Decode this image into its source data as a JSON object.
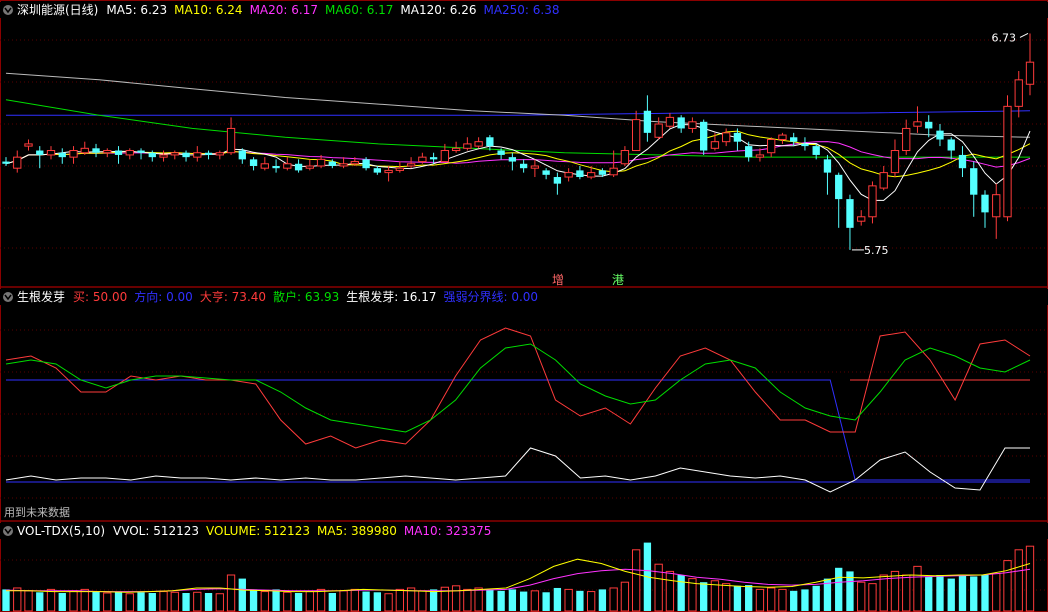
{
  "colors": {
    "bg": "#000000",
    "up": "#ff3b3b",
    "down": "#54ffff",
    "panel_border": "#8b0000",
    "grid": "#5a0000",
    "white": "#ffffff",
    "yellow": "#ffff00",
    "magenta": "#ff33ff",
    "green": "#00dd00",
    "blue": "#3030ff"
  },
  "panel1": {
    "title": "深圳能源(日线)",
    "icon": "chevron-down-icon",
    "indicators": [
      {
        "label": "MA5: 6.23",
        "color": "#ffffff"
      },
      {
        "label": "MA10: 6.24",
        "color": "#ffff00"
      },
      {
        "label": "MA20: 6.17",
        "color": "#ff33ff"
      },
      {
        "label": "MA60: 6.17",
        "color": "#00dd00"
      },
      {
        "label": "MA120: 6.26",
        "color": "#ffffff"
      },
      {
        "label": "MA250: 6.38",
        "color": "#3030ff"
      }
    ],
    "high_label": "6.73",
    "low_label": "5.75",
    "markers": [
      {
        "text": "增",
        "color": "#ff6666"
      },
      {
        "text": "港",
        "color": "#66ff66"
      }
    ]
  },
  "panel2": {
    "title": "生根发芽",
    "icon": "chevron-down-icon",
    "indicators": [
      {
        "label": "买: 50.00",
        "color": "#ff3b3b"
      },
      {
        "label": "方向: 0.00",
        "color": "#3030ff"
      },
      {
        "label": "大亨: 73.40",
        "color": "#ff3b3b"
      },
      {
        "label": "散户: 63.93",
        "color": "#00dd00"
      },
      {
        "label": "生根发芽: 16.17",
        "color": "#ffffff"
      },
      {
        "label": "强弱分界线: 0.00",
        "color": "#3030ff"
      }
    ],
    "footnote": "用到未来数据"
  },
  "panel3": {
    "title": "VOL-TDX(5,10)",
    "icon": "chevron-down-icon",
    "indicators": [
      {
        "label": "VVOL: 512123",
        "color": "#ffffff"
      },
      {
        "label": "VOLUME: 512123",
        "color": "#ffff00"
      },
      {
        "label": "MA5: 389980",
        "color": "#ffff00"
      },
      {
        "label": "MA10: 323375",
        "color": "#ff33ff"
      }
    ]
  },
  "chart_data": [
    {
      "type": "candlestick",
      "candles": [
        [
          6.15,
          6.14,
          6.17,
          6.13
        ],
        [
          6.12,
          6.17,
          6.2,
          6.1
        ],
        [
          6.22,
          6.23,
          6.25,
          6.2
        ],
        [
          6.2,
          6.18,
          6.22,
          6.12
        ],
        [
          6.18,
          6.2,
          6.22,
          6.16
        ],
        [
          6.19,
          6.17,
          6.21,
          6.14
        ],
        [
          6.17,
          6.2,
          6.22,
          6.14
        ],
        [
          6.19,
          6.21,
          6.24,
          6.18
        ],
        [
          6.21,
          6.19,
          6.23,
          6.17
        ],
        [
          6.19,
          6.2,
          6.21,
          6.17
        ],
        [
          6.2,
          6.18,
          6.22,
          6.14
        ],
        [
          6.18,
          6.2,
          6.21,
          6.16
        ],
        [
          6.2,
          6.19,
          6.21,
          6.16
        ],
        [
          6.19,
          6.17,
          6.2,
          6.15
        ],
        [
          6.17,
          6.18,
          6.2,
          6.15
        ],
        [
          6.18,
          6.19,
          6.2,
          6.16
        ],
        [
          6.19,
          6.17,
          6.2,
          6.15
        ],
        [
          6.17,
          6.19,
          6.22,
          6.15
        ],
        [
          6.19,
          6.18,
          6.2,
          6.16
        ],
        [
          6.18,
          6.19,
          6.2,
          6.16
        ],
        [
          6.19,
          6.3,
          6.35,
          6.18
        ],
        [
          6.2,
          6.16,
          6.21,
          6.14
        ],
        [
          6.16,
          6.13,
          6.17,
          6.11
        ],
        [
          6.12,
          6.14,
          6.17,
          6.11
        ],
        [
          6.13,
          6.12,
          6.16,
          6.1
        ],
        [
          6.12,
          6.14,
          6.17,
          6.11
        ],
        [
          6.14,
          6.11,
          6.16,
          6.1
        ],
        [
          6.12,
          6.13,
          6.16,
          6.11
        ],
        [
          6.13,
          6.16,
          6.18,
          6.12
        ],
        [
          6.15,
          6.13,
          6.16,
          6.12
        ],
        [
          6.13,
          6.14,
          6.17,
          6.12
        ],
        [
          6.14,
          6.15,
          6.17,
          6.13
        ],
        [
          6.16,
          6.12,
          6.17,
          6.11
        ],
        [
          6.12,
          6.1,
          6.13,
          6.09
        ],
        [
          6.1,
          6.11,
          6.13,
          6.06
        ],
        [
          6.11,
          6.12,
          6.15,
          6.1
        ],
        [
          6.13,
          6.14,
          6.17,
          6.12
        ],
        [
          6.15,
          6.17,
          6.19,
          6.14
        ],
        [
          6.17,
          6.16,
          6.19,
          6.14
        ],
        [
          6.15,
          6.2,
          6.23,
          6.15
        ],
        [
          6.2,
          6.21,
          6.24,
          6.19
        ],
        [
          6.21,
          6.23,
          6.26,
          6.2
        ],
        [
          6.22,
          6.24,
          6.26,
          6.21
        ],
        [
          6.26,
          6.22,
          6.27,
          6.2
        ],
        [
          6.2,
          6.18,
          6.21,
          6.16
        ],
        [
          6.17,
          6.15,
          6.19,
          6.11
        ],
        [
          6.14,
          6.12,
          6.16,
          6.1
        ],
        [
          6.12,
          6.13,
          6.16,
          6.08
        ],
        [
          6.11,
          6.09,
          6.12,
          6.07
        ],
        [
          6.08,
          6.05,
          6.1,
          6.0
        ],
        [
          6.08,
          6.1,
          6.12,
          6.06
        ],
        [
          6.11,
          6.08,
          6.13,
          6.07
        ],
        [
          6.08,
          6.1,
          6.13,
          6.07
        ],
        [
          6.11,
          6.09,
          6.12,
          6.08
        ],
        [
          6.09,
          6.12,
          6.2,
          6.08
        ],
        [
          6.14,
          6.2,
          6.22,
          6.13
        ],
        [
          6.2,
          6.34,
          6.38,
          6.2
        ],
        [
          6.38,
          6.28,
          6.45,
          6.24
        ],
        [
          6.26,
          6.32,
          6.35,
          6.25
        ],
        [
          6.31,
          6.35,
          6.37,
          6.3
        ],
        [
          6.35,
          6.3,
          6.36,
          6.28
        ],
        [
          6.3,
          6.33,
          6.35,
          6.28
        ],
        [
          6.33,
          6.2,
          6.34,
          6.18
        ],
        [
          6.21,
          6.24,
          6.28,
          6.2
        ],
        [
          6.24,
          6.28,
          6.3,
          6.22
        ],
        [
          6.28,
          6.24,
          6.3,
          6.2
        ],
        [
          6.22,
          6.17,
          6.24,
          6.15
        ],
        [
          6.17,
          6.18,
          6.21,
          6.15
        ],
        [
          6.19,
          6.25,
          6.26,
          6.17
        ],
        [
          6.25,
          6.27,
          6.28,
          6.23
        ],
        [
          6.26,
          6.24,
          6.28,
          6.22
        ],
        [
          6.23,
          6.22,
          6.26,
          6.2
        ],
        [
          6.22,
          6.18,
          6.23,
          6.16
        ],
        [
          6.16,
          6.1,
          6.18,
          6.0
        ],
        [
          6.09,
          5.98,
          6.1,
          5.85
        ],
        [
          5.98,
          5.85,
          6.0,
          5.75
        ],
        [
          5.88,
          5.9,
          5.93,
          5.86
        ],
        [
          5.9,
          6.04,
          6.06,
          5.87
        ],
        [
          6.03,
          6.1,
          6.13,
          6.02
        ],
        [
          6.1,
          6.2,
          6.25,
          6.08
        ],
        [
          6.2,
          6.3,
          6.34,
          6.18
        ],
        [
          6.31,
          6.33,
          6.4,
          6.28
        ],
        [
          6.33,
          6.3,
          6.36,
          6.26
        ],
        [
          6.29,
          6.25,
          6.32,
          6.22
        ],
        [
          6.25,
          6.2,
          6.26,
          6.16
        ],
        [
          6.18,
          6.12,
          6.22,
          6.08
        ],
        [
          6.12,
          6.0,
          6.15,
          5.9
        ],
        [
          6.0,
          5.92,
          6.02,
          5.85
        ],
        [
          5.9,
          6.0,
          6.05,
          5.8
        ],
        [
          5.9,
          6.4,
          6.45,
          5.88
        ],
        [
          6.4,
          6.52,
          6.56,
          6.35
        ],
        [
          6.5,
          6.6,
          6.73,
          6.45
        ]
      ],
      "ma_series": [
        {
          "name": "MA5",
          "color": "#ffffff"
        },
        {
          "name": "MA10",
          "color": "#ffff00"
        },
        {
          "name": "MA20",
          "color": "#ff33ff"
        },
        {
          "name": "MA60",
          "color": "#00dd00"
        },
        {
          "name": "MA120",
          "color": "#ffffff"
        },
        {
          "name": "MA250",
          "color": "#3030ff"
        }
      ],
      "ma250_points": [
        6.36,
        6.36,
        6.36,
        6.36,
        6.37,
        6.37,
        6.38
      ],
      "ma120_points": [
        6.55,
        6.52,
        6.48,
        6.44,
        6.41,
        6.38,
        6.36,
        6.33,
        6.31,
        6.29,
        6.27,
        6.26
      ],
      "ma60_points": [
        6.43,
        6.36,
        6.3,
        6.26,
        6.23,
        6.21,
        6.19,
        6.18,
        6.17,
        6.17,
        6.17,
        6.17
      ],
      "ylim": [
        5.65,
        6.8
      ]
    },
    {
      "type": "line",
      "series": [
        {
          "name": "大亨",
          "color": "#ff3b3b",
          "values": [
            60,
            62,
            56,
            44,
            44,
            52,
            50,
            52,
            50,
            50,
            48,
            30,
            18,
            22,
            16,
            20,
            18,
            30,
            52,
            70,
            76,
            72,
            40,
            32,
            36,
            28,
            46,
            62,
            66,
            60,
            44,
            30,
            30,
            24,
            24,
            72,
            74,
            60,
            40,
            68,
            70,
            62
          ]
        },
        {
          "name": "散户",
          "color": "#00dd00",
          "values": [
            58,
            60,
            58,
            50,
            46,
            50,
            52,
            52,
            51,
            50,
            50,
            44,
            36,
            30,
            28,
            26,
            24,
            30,
            40,
            56,
            66,
            68,
            60,
            48,
            42,
            38,
            40,
            50,
            58,
            60,
            56,
            44,
            36,
            32,
            30,
            44,
            60,
            66,
            62,
            56,
            54,
            60
          ]
        }
      ],
      "buy_line": 50,
      "direction_line": {
        "values": [
          50,
          50,
          50,
          50,
          50,
          50,
          50,
          50,
          50,
          50,
          50,
          50,
          50,
          50,
          50,
          50,
          50,
          50,
          50,
          50,
          50,
          50,
          50,
          50,
          50,
          50,
          50,
          50,
          50,
          50,
          50,
          50,
          50,
          50,
          0,
          0,
          0,
          0,
          0,
          0,
          0,
          0
        ],
        "color": "#3030ff"
      },
      "sprout_line": {
        "name": "生根发芽",
        "values": [
          0,
          2,
          0,
          1,
          1,
          0,
          2,
          1,
          1,
          0,
          1,
          0,
          1,
          0,
          0,
          1,
          2,
          1,
          0,
          1,
          2,
          16,
          12,
          1,
          2,
          0,
          2,
          6,
          4,
          2,
          1,
          2,
          0,
          -6,
          0,
          10,
          14,
          4,
          -4,
          -5,
          16,
          16
        ],
        "color": "#ffffff"
      },
      "divider_line": 0
    },
    {
      "type": "bar",
      "volume_relative": [
        0.3,
        0.32,
        0.28,
        0.26,
        0.3,
        0.25,
        0.28,
        0.3,
        0.27,
        0.25,
        0.26,
        0.24,
        0.26,
        0.25,
        0.27,
        0.26,
        0.25,
        0.26,
        0.25,
        0.24,
        0.5,
        0.45,
        0.3,
        0.27,
        0.3,
        0.26,
        0.25,
        0.27,
        0.3,
        0.25,
        0.28,
        0.3,
        0.27,
        0.26,
        0.24,
        0.3,
        0.32,
        0.28,
        0.3,
        0.33,
        0.35,
        0.3,
        0.32,
        0.3,
        0.28,
        0.3,
        0.27,
        0.28,
        0.26,
        0.32,
        0.3,
        0.28,
        0.27,
        0.3,
        0.32,
        0.4,
        0.85,
        0.95,
        0.65,
        0.55,
        0.5,
        0.45,
        0.4,
        0.42,
        0.38,
        0.35,
        0.36,
        0.3,
        0.32,
        0.3,
        0.28,
        0.3,
        0.35,
        0.45,
        0.6,
        0.55,
        0.4,
        0.38,
        0.5,
        0.55,
        0.5,
        0.62,
        0.48,
        0.5,
        0.45,
        0.5,
        0.48,
        0.5,
        0.52,
        0.7,
        0.85,
        0.9
      ],
      "ma5_rel": [
        0.28,
        0.28,
        0.27,
        0.27,
        0.27,
        0.26,
        0.27,
        0.28,
        0.32,
        0.32,
        0.29,
        0.28,
        0.27,
        0.27,
        0.28,
        0.3,
        0.29,
        0.28,
        0.27,
        0.28,
        0.3,
        0.32,
        0.45,
        0.62,
        0.72,
        0.66,
        0.55,
        0.47,
        0.42,
        0.38,
        0.36,
        0.34,
        0.33,
        0.34,
        0.4,
        0.47,
        0.46,
        0.48,
        0.5,
        0.49,
        0.5,
        0.5,
        0.56,
        0.66
      ],
      "ma10_rel": [
        0.29,
        0.28,
        0.28,
        0.28,
        0.27,
        0.27,
        0.27,
        0.28,
        0.3,
        0.31,
        0.3,
        0.29,
        0.28,
        0.28,
        0.28,
        0.29,
        0.29,
        0.28,
        0.28,
        0.28,
        0.29,
        0.3,
        0.36,
        0.45,
        0.52,
        0.56,
        0.58,
        0.56,
        0.52,
        0.47,
        0.44,
        0.4,
        0.37,
        0.36,
        0.37,
        0.4,
        0.42,
        0.45,
        0.47,
        0.48,
        0.49,
        0.5,
        0.53,
        0.58
      ]
    }
  ]
}
